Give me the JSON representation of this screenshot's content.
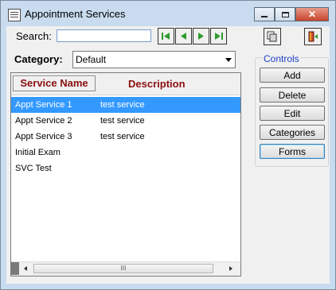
{
  "window": {
    "title": "Appointment Services"
  },
  "search": {
    "label": "Search:",
    "value": "",
    "placeholder": ""
  },
  "category": {
    "label": "Category:",
    "selected": "Default"
  },
  "list": {
    "headers": {
      "name": "Service Name",
      "description": "Description"
    },
    "rows": [
      {
        "name": "Appt Service 1",
        "description": "test service",
        "selected": true
      },
      {
        "name": "Appt Service 2",
        "description": "test service"
      },
      {
        "name": "Appt Service 3",
        "description": "test service"
      },
      {
        "name": "Initial Exam",
        "description": ""
      },
      {
        "name": "SVC Test",
        "description": ""
      }
    ],
    "scroll_thumb_grip": "III"
  },
  "controls": {
    "title": "Controls",
    "add": "Add",
    "delete": "Delete",
    "edit": "Edit",
    "categories": "Categories",
    "forms": "Forms"
  },
  "icons": {
    "app": "app-list-icon",
    "minimize": "minimize-icon",
    "maximize": "maximize-icon",
    "close": "close-icon",
    "first": "first-record-icon",
    "prev": "previous-record-icon",
    "next": "next-record-icon",
    "last": "last-record-icon",
    "copy": "copy-icon",
    "exit": "exit-door-icon"
  },
  "colors": {
    "selection": "#3399ff",
    "header_text": "#8b1010",
    "controls_title": "#1f3fc8",
    "nav_green": "#2e9b2e",
    "close_button": "#c8452e"
  }
}
